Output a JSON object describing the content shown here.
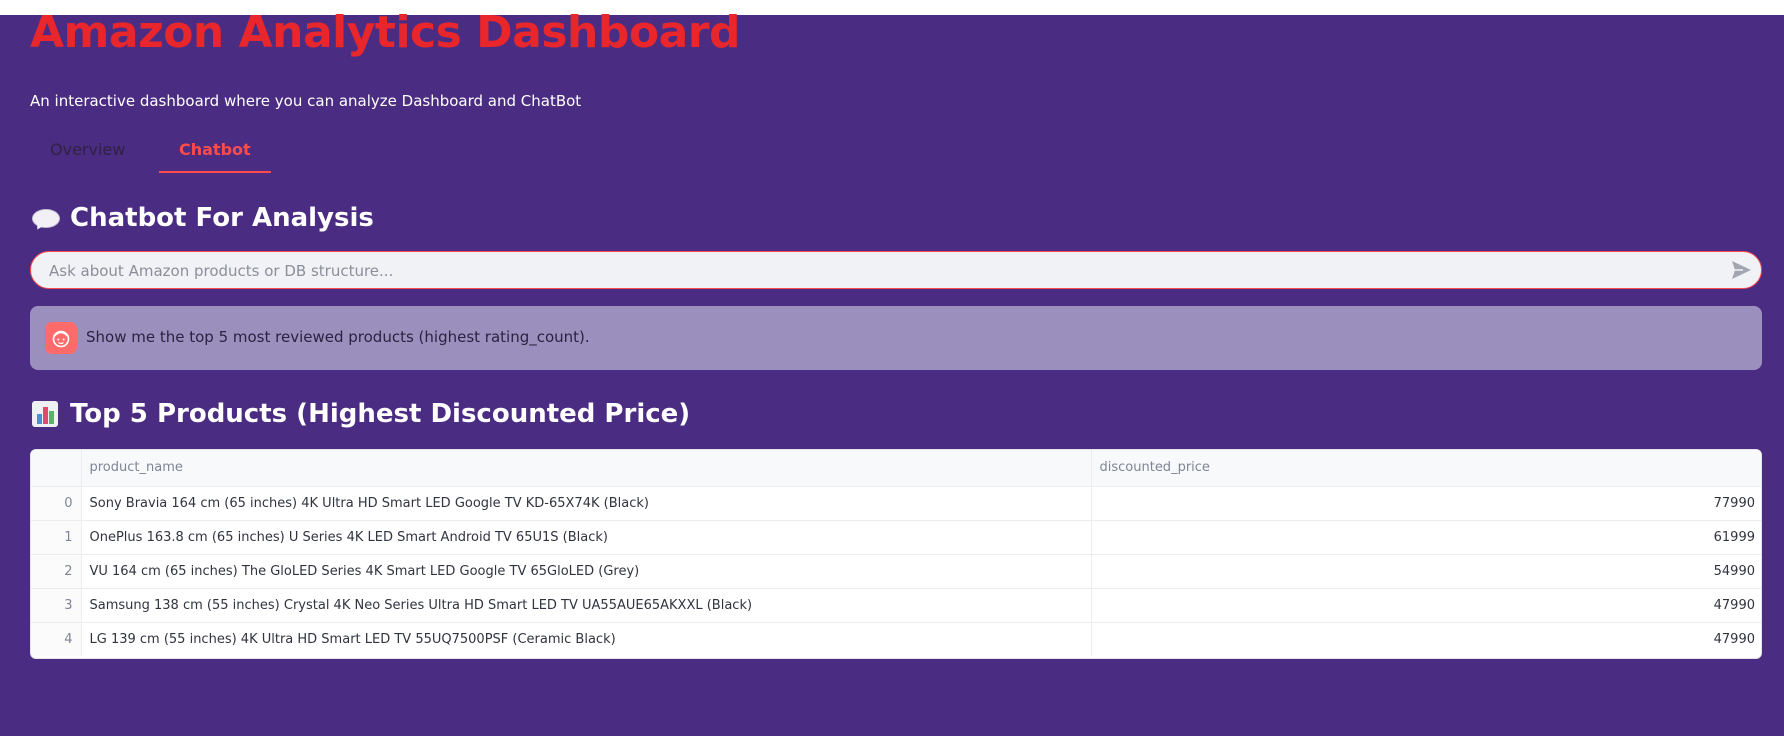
{
  "app": {
    "title": "Amazon Analytics Dashboard",
    "subtitle": "An interactive dashboard where you can analyze Dashboard and ChatBot"
  },
  "tabs": [
    {
      "label": "Overview",
      "active": false
    },
    {
      "label": "Chatbot",
      "active": true
    }
  ],
  "chat": {
    "heading": "Chatbot For Analysis",
    "heading_icon": "speech-bubble-icon",
    "input_placeholder": "Ask about Amazon products or DB structure...",
    "input_value": "",
    "send_icon": "send-arrow-icon",
    "user_message": "Show me the top 5 most reviewed products (highest rating_count)."
  },
  "results": {
    "heading": "Top 5 Products (Highest Discounted Price)",
    "heading_icon": "bar-chart-icon",
    "columns": [
      "",
      "product_name",
      "discounted_price"
    ],
    "rows": [
      {
        "index": "0",
        "product_name": "Sony Bravia 164 cm (65 inches) 4K Ultra HD Smart LED Google TV KD-65X74K (Black)",
        "discounted_price": "77990"
      },
      {
        "index": "1",
        "product_name": "OnePlus 163.8 cm (65 inches) U Series 4K LED Smart Android TV 65U1S (Black)",
        "discounted_price": "61999"
      },
      {
        "index": "2",
        "product_name": "VU 164 cm (65 inches) The GloLED Series 4K Smart LED Google TV 65GloLED (Grey)",
        "discounted_price": "54990"
      },
      {
        "index": "3",
        "product_name": "Samsung 138 cm (55 inches) Crystal 4K Neo Series Ultra HD Smart LED TV UA55AUE65AKXXL (Black)",
        "discounted_price": "47990"
      },
      {
        "index": "4",
        "product_name": "LG 139 cm (55 inches) 4K Ultra HD Smart LED TV 55UQ7500PSF (Ceramic Black)",
        "discounted_price": "47990"
      }
    ]
  },
  "colors": {
    "background": "#4b2c83",
    "title": "#e8262b",
    "accent": "#ff4b4b",
    "message_bg": "#9b8fbe"
  }
}
